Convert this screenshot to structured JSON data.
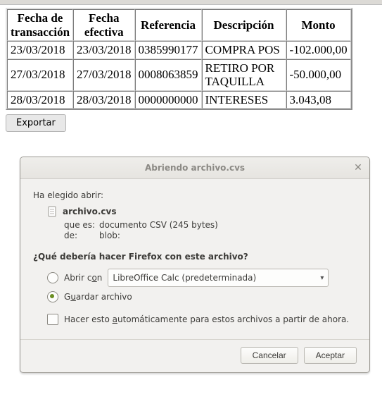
{
  "table": {
    "headers": {
      "transaccion": "Fecha de\ntransacción",
      "efectiva": "Fecha\nefectiva",
      "referencia": "Referencia",
      "descripcion": "Descripción",
      "monto": "Monto"
    },
    "rows": [
      {
        "transaccion": "23/03/2018",
        "efectiva": "23/03/2018",
        "referencia": "0385990177",
        "descripcion": "COMPRA POS",
        "monto": "-102.000,00"
      },
      {
        "transaccion": "27/03/2018",
        "efectiva": "27/03/2018",
        "referencia": "0008063859",
        "descripcion": "RETIRO POR TAQUILLA",
        "monto": "-50.000,00"
      },
      {
        "transaccion": "28/03/2018",
        "efectiva": "28/03/2018",
        "referencia": "0000000000",
        "descripcion": "INTERESES",
        "monto": "3.043,08"
      }
    ]
  },
  "export_button": "Exportar",
  "dialog": {
    "title": "Abriendo archivo.cvs",
    "chosen_label": "Ha elegido abrir:",
    "filename": "archivo.cvs",
    "que_es_label": "que es:",
    "que_es_value": "documento CSV (245 bytes)",
    "de_label": "de:",
    "de_value": "blob:",
    "question": "¿Qué debería hacer Firefox con este archivo?",
    "open_with_prefix": "Abrir c",
    "open_with_underline": "o",
    "open_with_suffix": "n",
    "open_with_app": "LibreOffice Calc (predeterminada)",
    "save_prefix": "G",
    "save_underline": "u",
    "save_suffix": "ardar archivo",
    "auto_prefix": "Hacer esto ",
    "auto_underline": "a",
    "auto_suffix": "utomáticamente para estos archivos a partir de ahora.",
    "cancel": "Cancelar",
    "accept": "Aceptar"
  }
}
